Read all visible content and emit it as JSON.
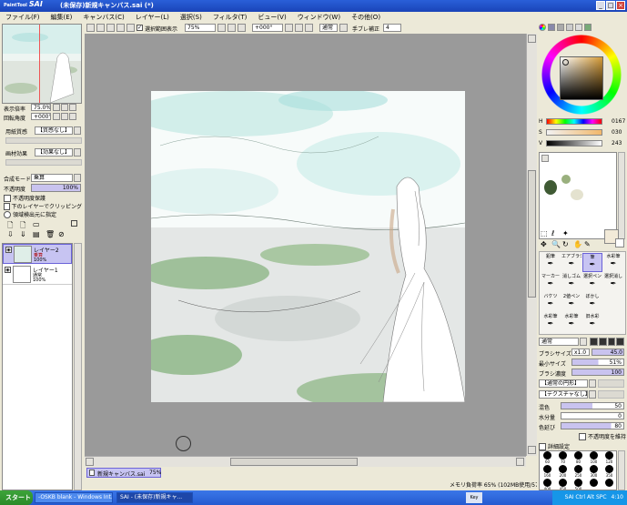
{
  "app": {
    "logo_small": "PaintTool",
    "logo": "SAI",
    "title": "(未保存)新規キャンバス.sai (*)"
  },
  "window_buttons": [
    "_",
    "□",
    "×"
  ],
  "menu": [
    "ファイル(F)",
    "編集(E)",
    "キャンバス(C)",
    "レイヤー(L)",
    "選択(S)",
    "フィルタ(T)",
    "ビュー(V)",
    "ウィンドウ(W)",
    "その他(O)"
  ],
  "navigator": {
    "zoom_label": "表示倍率",
    "zoom_value": "75.0%",
    "rotate_label": "回転角度",
    "rotate_value": "+000°"
  },
  "paper": {
    "label": "用紙質感",
    "value": "【質感なし】",
    "effect_label": "画材効果",
    "effect_value": "【効果なし】"
  },
  "layer_props": {
    "blend_label": "合成モード",
    "blend_value": "乗算",
    "opacity_label": "不透明度",
    "opacity_value": "100%",
    "check1": "不透明度保護",
    "check2": "下のレイヤーでクリッピング",
    "check3": "領域検出元に指定"
  },
  "layers": [
    {
      "name": "レイヤー2",
      "mode": "乗算",
      "opacity": "100%",
      "selected": true
    },
    {
      "name": "レイヤー1",
      "mode": "通常",
      "opacity": "100%",
      "selected": false
    }
  ],
  "toolbar": {
    "selection_check": "選択範囲表示",
    "zoom": "75%",
    "angle": "+000°",
    "mode": "通常",
    "stabilizer_label": "手ブレ補正",
    "stabilizer_value": "4"
  },
  "color": {
    "h_label": "H",
    "h_value": "0167",
    "s_label": "S",
    "s_value": "030",
    "v_label": "V",
    "v_value": "243",
    "wheel_colors": [
      "#ff0000",
      "#ffff00",
      "#00ff00",
      "#00ffff",
      "#0000ff",
      "#ff00ff"
    ],
    "current": "#f2ead8",
    "swatches": [
      "#3f5a34",
      "#9ab07e",
      "#e4e2cf"
    ]
  },
  "tools": [
    {
      "name": "鉛筆"
    },
    {
      "name": "エアブラシ"
    },
    {
      "name": "筆"
    },
    {
      "name": "水彩筆"
    },
    {
      "name": "マーカー"
    },
    {
      "name": "消しゴム"
    },
    {
      "name": "選択ペン"
    },
    {
      "name": "選択消し"
    },
    {
      "name": "バケツ"
    },
    {
      "name": "2値ペン"
    },
    {
      "name": "ぼかし"
    },
    {
      "name": ""
    },
    {
      "name": "水彩筆"
    },
    {
      "name": "水彩筆"
    },
    {
      "name": "旧水彩"
    },
    {
      "name": ""
    }
  ],
  "tool_sub": [
    "1補正",
    "10補正",
    ""
  ],
  "brush": {
    "mode": "通常",
    "size_label": "ブラシサイズ",
    "size_mult": "x1.0",
    "size_value": "45.0",
    "min_label": "最小サイズ",
    "min_value": "51%",
    "density_label": "ブラシ濃度",
    "density_value": "100",
    "shape": "【通常の円形】",
    "texture": "【テクスチャなし】",
    "mix_label": "混色",
    "mix_value": "50",
    "water_label": "水分量",
    "water_value": "0",
    "persist_label": "色延び",
    "persist_value": "80",
    "keep_opacity": "不透明度を維持",
    "detail": "詳細設定"
  },
  "brush_sizes": [
    "60",
    "70",
    "80",
    "100",
    "120",
    "160",
    "200",
    "250",
    "300",
    "350",
    "400",
    "450",
    "500",
    "",
    ""
  ],
  "canvas_tab": {
    "name": "新規キャンバス.sai",
    "zoom": "75%"
  },
  "status": {
    "memory": "メモリ負荷率 65% (102MB使用/572MB確保)"
  },
  "taskbar": {
    "start": "スタート",
    "tasks": [
      "-OSKB blank - Windows Int...",
      "SAI - (未保存)新規キャ..."
    ],
    "tray_time": "4:10",
    "tray_text": "SAI Ctrl Alt SPC",
    "lang": "Key"
  }
}
